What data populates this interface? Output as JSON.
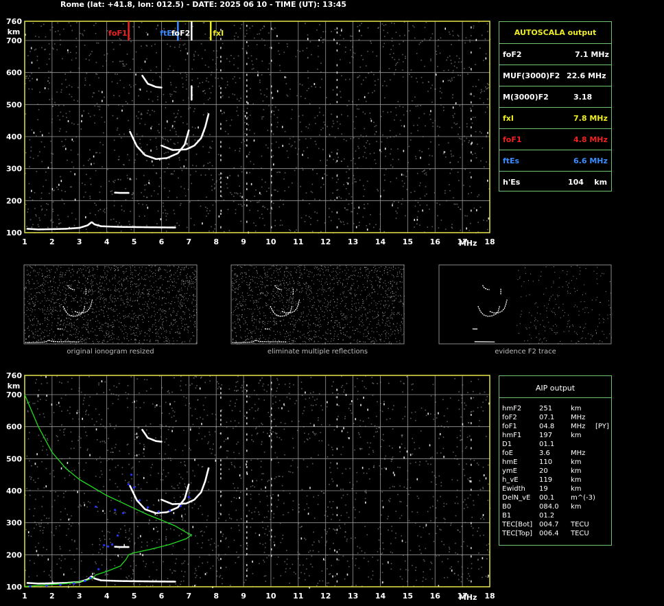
{
  "header": {
    "title": "Rome (lat: +41.8, lon: 012.5) - DATE: 2025 06 10 - TIME (UT): 13:45"
  },
  "colors": {
    "frame": "#e6e64c",
    "grid": "#9a9a9a",
    "trace": "#ffffff",
    "noise": "#9a9a9a",
    "profile": "#22dd22",
    "aip_points": "#2233ff",
    "panel_border": "#6fc86f",
    "foF1": "#ee2222",
    "ftEs": "#3a8cff",
    "foF2": "#ffffff",
    "fxI": "#eeee22"
  },
  "chart_data": [
    {
      "type": "scatter",
      "id": "main-ionogram",
      "xlabel": "MHz",
      "ylabel": "km",
      "xlim": [
        1,
        18
      ],
      "ylim": [
        100,
        760
      ],
      "x_ticks": [
        1,
        2,
        3,
        4,
        5,
        6,
        7,
        8,
        9,
        10,
        11,
        12,
        13,
        14,
        15,
        16,
        17,
        18
      ],
      "y_ticks": [
        100,
        200,
        300,
        400,
        500,
        600,
        700,
        760
      ],
      "grid": true,
      "markers": [
        {
          "label": "foF1",
          "freq": 4.8,
          "color": "#ee2222"
        },
        {
          "label": "ftEs",
          "freq": 6.6,
          "color": "#3a8cff"
        },
        {
          "label": "foF2",
          "freq": 7.1,
          "color": "#ffffff"
        },
        {
          "label": "fxI",
          "freq": 7.8,
          "color": "#eeee22"
        }
      ],
      "series": [
        {
          "id": "es-trace",
          "points": [
            [
              1.1,
              112
            ],
            [
              1.5,
              110
            ],
            [
              2.0,
              111
            ],
            [
              2.5,
              112
            ],
            [
              3.0,
              115
            ],
            [
              3.3,
              123
            ],
            [
              3.45,
              133
            ],
            [
              3.55,
              126
            ],
            [
              3.8,
              120
            ],
            [
              4.5,
              118
            ],
            [
              5.5,
              117
            ],
            [
              6.5,
              116
            ]
          ]
        },
        {
          "id": "es-second-hop",
          "points": [
            [
              4.3,
              225
            ],
            [
              4.5,
              224
            ],
            [
              4.8,
              224
            ]
          ]
        },
        {
          "id": "f1-o-trace",
          "points": [
            [
              4.85,
              415
            ],
            [
              5.1,
              370
            ],
            [
              5.4,
              342
            ],
            [
              5.8,
              330
            ],
            [
              6.2,
              333
            ],
            [
              6.6,
              348
            ],
            [
              6.85,
              375
            ],
            [
              7.0,
              420
            ]
          ]
        },
        {
          "id": "f2-x-trace",
          "points": [
            [
              6.0,
              372
            ],
            [
              6.4,
              358
            ],
            [
              6.9,
              360
            ],
            [
              7.2,
              372
            ],
            [
              7.45,
              395
            ],
            [
              7.6,
              430
            ],
            [
              7.72,
              470
            ]
          ]
        },
        {
          "id": "f2-upper-trace",
          "points": [
            [
              5.3,
              590
            ],
            [
              5.5,
              565
            ],
            [
              5.8,
              555
            ],
            [
              6.0,
              553
            ]
          ]
        },
        {
          "id": "spike-7",
          "points": [
            [
              7.1,
              515
            ],
            [
              7.1,
              560
            ]
          ]
        }
      ]
    },
    {
      "type": "scatter",
      "id": "aip-ionogram",
      "xlabel": "MHz",
      "ylabel": "km",
      "xlim": [
        1,
        18
      ],
      "ylim": [
        100,
        760
      ],
      "x_ticks": [
        1,
        2,
        3,
        4,
        5,
        6,
        7,
        8,
        9,
        10,
        11,
        12,
        13,
        14,
        15,
        16,
        17,
        18
      ],
      "y_ticks": [
        100,
        200,
        300,
        400,
        500,
        600,
        700,
        760
      ],
      "grid": true,
      "series": [
        {
          "id": "es-trace",
          "points": [
            [
              1.1,
              112
            ],
            [
              1.5,
              110
            ],
            [
              2.0,
              111
            ],
            [
              2.5,
              112
            ],
            [
              3.0,
              115
            ],
            [
              3.3,
              123
            ],
            [
              3.45,
              133
            ],
            [
              3.55,
              126
            ],
            [
              3.8,
              120
            ],
            [
              4.5,
              118
            ],
            [
              5.5,
              117
            ],
            [
              6.5,
              116
            ]
          ]
        },
        {
          "id": "es-second-hop",
          "points": [
            [
              4.3,
              225
            ],
            [
              4.5,
              224
            ],
            [
              4.8,
              224
            ]
          ]
        },
        {
          "id": "f1-o-trace",
          "points": [
            [
              4.85,
              415
            ],
            [
              5.1,
              370
            ],
            [
              5.4,
              342
            ],
            [
              5.8,
              330
            ],
            [
              6.2,
              333
            ],
            [
              6.6,
              348
            ],
            [
              6.85,
              375
            ],
            [
              7.0,
              420
            ]
          ]
        },
        {
          "id": "f2-x-trace",
          "points": [
            [
              6.0,
              372
            ],
            [
              6.4,
              358
            ],
            [
              6.9,
              360
            ],
            [
              7.2,
              372
            ],
            [
              7.45,
              395
            ],
            [
              7.6,
              430
            ],
            [
              7.72,
              470
            ]
          ]
        },
        {
          "id": "f2-upper-trace",
          "points": [
            [
              5.3,
              590
            ],
            [
              5.5,
              565
            ],
            [
              5.8,
              555
            ],
            [
              6.0,
              553
            ]
          ]
        },
        {
          "id": "electron-density-profile",
          "color": "#22dd22",
          "points": [
            [
              1.0,
              700
            ],
            [
              1.5,
              600
            ],
            [
              2.0,
              520
            ],
            [
              2.5,
              470
            ],
            [
              3.0,
              435
            ],
            [
              3.5,
              410
            ],
            [
              4.0,
              385
            ],
            [
              4.5,
              365
            ],
            [
              5.0,
              345
            ],
            [
              5.5,
              325
            ],
            [
              6.0,
              308
            ],
            [
              6.5,
              290
            ],
            [
              6.9,
              270
            ],
            [
              7.1,
              262
            ],
            [
              6.9,
              250
            ],
            [
              6.3,
              232
            ],
            [
              5.6,
              217
            ],
            [
              5.0,
              206
            ],
            [
              4.8,
              200
            ],
            [
              4.7,
              185
            ],
            [
              4.5,
              165
            ],
            [
              4.0,
              148
            ],
            [
              3.6,
              137
            ],
            [
              3.5,
              128
            ],
            [
              3.2,
              118
            ],
            [
              2.5,
              110
            ],
            [
              1.5,
              104
            ],
            [
              1.0,
              101
            ]
          ]
        },
        {
          "id": "aip-fitted-points",
          "color": "#2233ff",
          "points": [
            [
              1.2,
              101
            ],
            [
              1.8,
              103
            ],
            [
              2.3,
              106
            ],
            [
              2.8,
              110
            ],
            [
              3.2,
              118
            ],
            [
              3.4,
              128
            ],
            [
              3.7,
              155
            ],
            [
              3.9,
              230
            ],
            [
              4.05,
              226
            ],
            [
              4.2,
              232
            ],
            [
              4.4,
              260
            ],
            [
              4.6,
              330
            ],
            [
              4.8,
              420
            ],
            [
              4.9,
              450
            ],
            [
              5.0,
              410
            ],
            [
              5.2,
              370
            ],
            [
              5.5,
              348
            ],
            [
              5.9,
              335
            ],
            [
              6.3,
              338
            ],
            [
              6.7,
              352
            ],
            [
              7.0,
              380
            ],
            [
              3.6,
              350
            ],
            [
              4.3,
              340
            ]
          ]
        }
      ]
    }
  ],
  "thumbnails": [
    {
      "caption": "original ionogram resized"
    },
    {
      "caption": "eliminate multiple reflections"
    },
    {
      "caption": "evidence F2 trace"
    }
  ],
  "autoscala": {
    "title": "AUTOSCALA output",
    "rows": [
      {
        "label": "foF2",
        "value": "7.1 MHz",
        "color": "#ffffff"
      },
      {
        "label": "MUF(3000)F2",
        "value": "22.6 MHz",
        "color": "#ffffff"
      },
      {
        "label": "M(3000)F2",
        "value": "3.18",
        "color": "#ffffff"
      },
      {
        "label": "fxI",
        "value": "7.8 MHz",
        "color": "#eeee22"
      },
      {
        "label": "foF1",
        "value": "4.8 MHz",
        "color": "#ee2222"
      },
      {
        "label": "ftEs",
        "value": "6.6 MHz",
        "color": "#3a8cff"
      },
      {
        "label": "h'Es",
        "value": "104    km",
        "color": "#ffffff"
      }
    ]
  },
  "aip": {
    "title": "AIP output",
    "rows": [
      {
        "name": "hmF2",
        "value": "251",
        "unit": "km",
        "flag": ""
      },
      {
        "name": "foF2",
        "value": "07.1",
        "unit": "MHz",
        "flag": ""
      },
      {
        "name": "foF1",
        "value": "04.8",
        "unit": "MHz",
        "flag": "[PY]"
      },
      {
        "name": "hmF1",
        "value": "197",
        "unit": "km",
        "flag": ""
      },
      {
        "name": "D1",
        "value": "01.1",
        "unit": "",
        "flag": ""
      },
      {
        "name": "foE",
        "value": "3.6",
        "unit": "MHz",
        "flag": ""
      },
      {
        "name": "hmE",
        "value": "110",
        "unit": "km",
        "flag": ""
      },
      {
        "name": "ymE",
        "value": "20",
        "unit": "km",
        "flag": ""
      },
      {
        "name": "h_vE",
        "value": "119",
        "unit": "km",
        "flag": ""
      },
      {
        "name": "Ewidth",
        "value": "19",
        "unit": "km",
        "flag": ""
      },
      {
        "name": "DelN_vE",
        "value": "00.1",
        "unit": "m^(-3)",
        "flag": ""
      },
      {
        "name": "B0",
        "value": "084.0",
        "unit": "km",
        "flag": ""
      },
      {
        "name": "B1",
        "value": "01.2",
        "unit": "",
        "flag": ""
      },
      {
        "name": "TEC[Bot]",
        "value": "004.7",
        "unit": "TECU",
        "flag": ""
      },
      {
        "name": "TEC[Top]",
        "value": "006.4",
        "unit": "TECU",
        "flag": ""
      }
    ]
  }
}
